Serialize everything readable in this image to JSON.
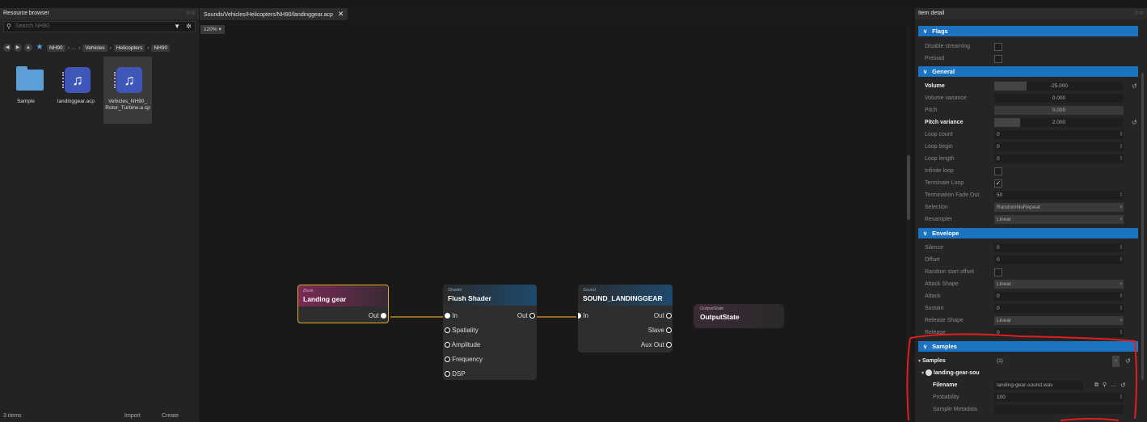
{
  "resource_browser": {
    "title": "Resource browser",
    "search_placeholder": "Search NH90",
    "breadcrumb": [
      "NH90",
      "...",
      "Vehicles",
      "Helicopters",
      "NH90"
    ],
    "items": [
      "Sample",
      "landinggear.acp",
      "Vehicles_NH90_ Rotor_Turbine.a cp"
    ],
    "footer": {
      "count": "3 items",
      "import": "Import",
      "create": "Create"
    }
  },
  "editor": {
    "tab": "Sounds/Vehicles/Helicopters/NH90/landinggear.acp",
    "zoom": "120%",
    "nodes": {
      "bank": {
        "type": "Bank",
        "title": "Landing gear",
        "out": "Out"
      },
      "shader": {
        "type": "Shader",
        "title": "Flush Shader",
        "in": "In",
        "out": "Out",
        "inputs": [
          "Spatiality",
          "Amplitude",
          "Frequency",
          "DSP"
        ]
      },
      "sound": {
        "type": "Sound",
        "title": "SOUND_LANDINGGEAR",
        "in": "In",
        "outputs": [
          "Out",
          "Slave",
          "Aux Out"
        ]
      },
      "output": {
        "type": "OutputState",
        "title": "OutputState"
      }
    },
    "colors": {
      "link": "#e8a020",
      "bank_head": "#8a2a5e",
      "shader_head": "#1e4a6e",
      "sound_head": "#1e4a6e",
      "selection": "#e0b020"
    }
  },
  "item_detail": {
    "title": "Item detail",
    "sections": {
      "flags": "Flags",
      "general": "General",
      "envelope": "Envelope",
      "samples": "Samples"
    },
    "flags": {
      "disable_streaming": "Disable streaming",
      "preload": "Preload"
    },
    "general": {
      "volume": {
        "label": "Volume",
        "value": "-25.000",
        "fill": 0.25
      },
      "volume_variance": {
        "label": "Volume variance",
        "value": "0.000"
      },
      "pitch": {
        "label": "Pitch",
        "value": "0.000"
      },
      "pitch_variance": {
        "label": "Pitch variance",
        "value": "2.000",
        "fill": 0.2
      },
      "loop_count": {
        "label": "Loop count",
        "value": "0"
      },
      "loop_begin": {
        "label": "Loop begin",
        "value": "0"
      },
      "loop_length": {
        "label": "Loop length",
        "value": "0"
      },
      "infinite_loop": {
        "label": "Infinite loop"
      },
      "terminate_loop": {
        "label": "Terminate Loop",
        "checked": true
      },
      "termination_fade_out": {
        "label": "Termination Fade Out",
        "value": "50"
      },
      "selection": {
        "label": "Selection",
        "value": "RandomNoRepeat"
      },
      "resampler": {
        "label": "Resampler",
        "value": "Linear"
      }
    },
    "envelope": {
      "silence": {
        "label": "Silence",
        "value": "0"
      },
      "offset": {
        "label": "Offset",
        "value": "0"
      },
      "random_start_offset": {
        "label": "Random start offset"
      },
      "attack_shape": {
        "label": "Attack Shape",
        "value": "Linear"
      },
      "attack": {
        "label": "Attack",
        "value": "0"
      },
      "sustain": {
        "label": "Sustain",
        "value": "0"
      },
      "release_shape": {
        "label": "Release Shape",
        "value": "Linear"
      },
      "release": {
        "label": "Release",
        "value": "0"
      }
    },
    "samples": {
      "samples_label": "Samples",
      "samples_value": "{1}",
      "entry": "landing-gear-sou",
      "filename": {
        "label": "Filename",
        "value": "landing-gear-sound.wav"
      },
      "probability": {
        "label": "Probability",
        "value": "100"
      },
      "sample_metadata": {
        "label": "Sample Metadata"
      }
    }
  }
}
